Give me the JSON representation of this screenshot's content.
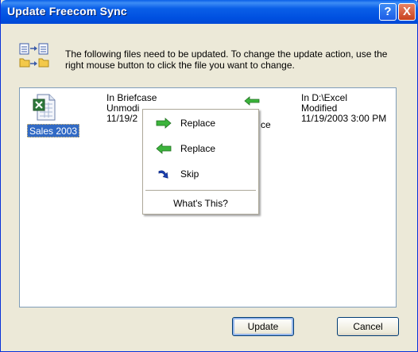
{
  "window": {
    "title": "Update Freecom Sync",
    "help_button": "?",
    "close_button": "X"
  },
  "header": {
    "icon": "update-files-icon",
    "message": "The following files need to be updated. To change the update action, use the right mouse button to click the file you want to change."
  },
  "file": {
    "name": "Sales 2003",
    "icon": "excel-file-icon",
    "left_location": "In Briefcase",
    "left_status": "Unmodi",
    "left_date": "11/19/2",
    "action_icon": "arrow-left-icon",
    "right_location": "In D:\\Excel",
    "right_status": "Modified",
    "right_date": "11/19/2003 3:00 PM",
    "hidden_text": "ce"
  },
  "context_menu": {
    "items": [
      {
        "label": "Replace",
        "icon": "arrow-right-icon"
      },
      {
        "label": "Replace",
        "icon": "arrow-left-icon"
      },
      {
        "label": "Skip",
        "icon": "skip-arrow-icon"
      }
    ],
    "whats_this": "What's This?"
  },
  "buttons": {
    "update": "Update",
    "cancel": "Cancel"
  },
  "colors": {
    "arrow_green": "#3cb43c",
    "skip_blue": "#1a3fb0",
    "selection": "#316ac5"
  }
}
